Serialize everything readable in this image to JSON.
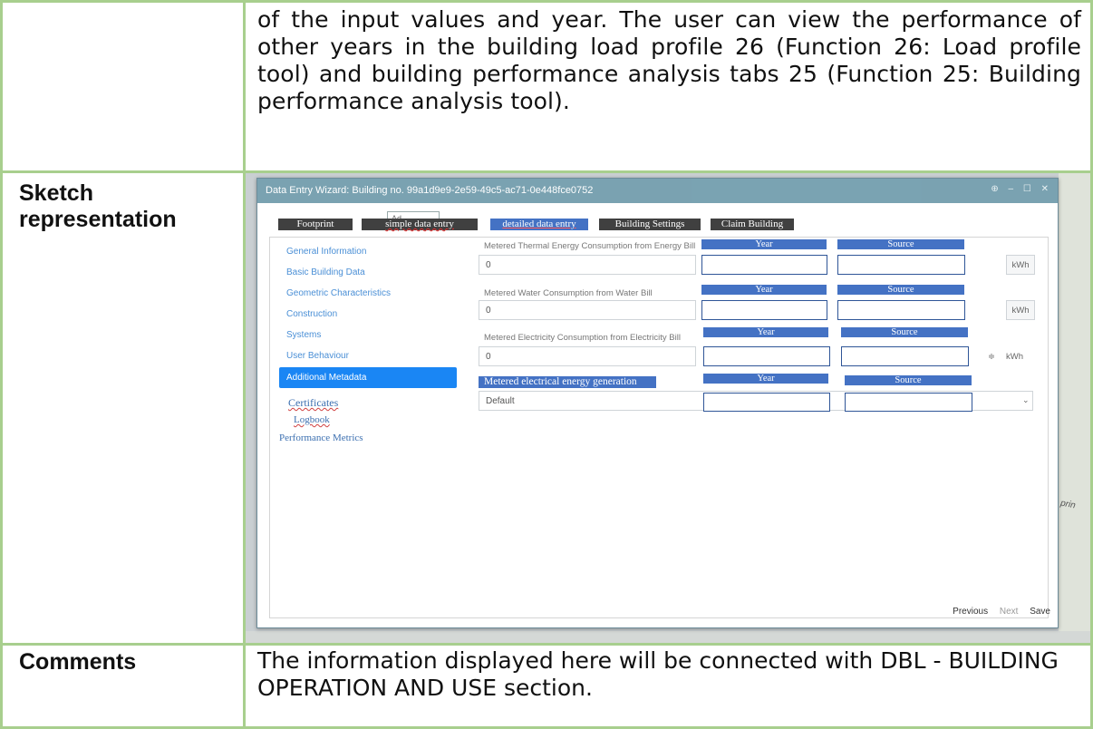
{
  "doc": {
    "top_paragraph": "of the input values and year. The user can view the performance of other years in the building load profile 26 (Function 26: Load profile tool) and building performance analysis tabs 25 (Function 25: Building performance analysis tool).",
    "sketch_label_line1": "Sketch",
    "sketch_label_line2": "representation",
    "comments_label": "Comments",
    "comments_text": "The information displayed here will be connected with DBL - BUILDING OPERATION AND USE section."
  },
  "sketch": {
    "window_title": "Data Entry Wizard: Building no. 99a1d9e9-2e59-49c5-ac71-0e448fce0752",
    "window_controls": "⊕ – ☐ ✕",
    "ghost_input": "Ad",
    "map_text": "prin",
    "tabs": {
      "footprint": "Footprint",
      "simple": "simple data entry",
      "detailed": "detailed data entry",
      "settings": "Building Settings",
      "claim": "Claim Building"
    },
    "sidebar": {
      "general": "General Information",
      "basic": "Basic Building Data",
      "geometric": "Geometric Characteristics",
      "construction": "Construction",
      "systems": "Systems",
      "user": "User Behaviour",
      "additional": "Additional Metadata",
      "certificates": "Certificates",
      "logbook": "Logbook",
      "performance": "Performance Metrics"
    },
    "form": {
      "thermal_label": "Metered Thermal Energy Consumption from Energy Bill",
      "water_label": "Metered Water Consumption from Water Bill",
      "electricity_label": "Metered Electricity Consumption from Electricity Bill",
      "generation_label": "Metered electrical energy generation",
      "year_header": "Year",
      "source_header": "Source",
      "thermal_value": "0",
      "water_value": "0",
      "electricity_value": "0",
      "generation_value": "Default",
      "unit": "kWh",
      "spinner": "≑",
      "select_caret": "⌄"
    },
    "footer": {
      "previous": "Previous",
      "next": "Next",
      "save": "Save"
    }
  }
}
